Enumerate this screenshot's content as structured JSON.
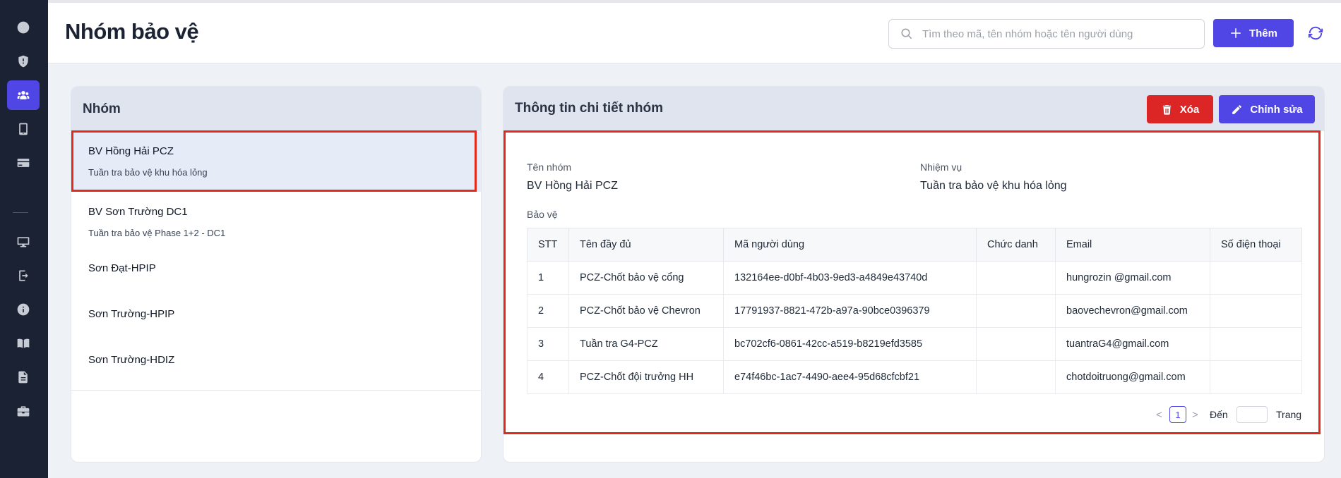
{
  "header": {
    "title": "Nhóm bảo vệ",
    "search_placeholder": "Tìm theo mã, tên nhóm hoặc tên người dùng",
    "add_label": "Thêm"
  },
  "sidebar": {
    "items": [
      {
        "icon": "clock-icon"
      },
      {
        "icon": "shield-icon"
      },
      {
        "icon": "users-icon",
        "active": true
      },
      {
        "icon": "tablet-icon"
      },
      {
        "icon": "credit-card-icon"
      },
      {
        "icon": "monitor-icon"
      },
      {
        "icon": "login-icon"
      },
      {
        "icon": "info-icon"
      },
      {
        "icon": "book-icon"
      },
      {
        "icon": "file-icon"
      },
      {
        "icon": "briefcase-icon"
      }
    ]
  },
  "groups_panel": {
    "title": "Nhóm",
    "items": [
      {
        "name": "BV Hồng Hải PCZ",
        "desc": "Tuần tra bảo vệ khu hóa lỏng"
      },
      {
        "name": "BV Sơn Trường DC1",
        "desc": "Tuần tra bảo vệ Phase 1+2 - DC1"
      },
      {
        "name": "Sơn Đạt-HPIP",
        "desc": ""
      },
      {
        "name": "Sơn Trường-HPIP",
        "desc": ""
      },
      {
        "name": "Sơn Trường-HDIZ",
        "desc": ""
      }
    ]
  },
  "detail_panel": {
    "title": "Thông tin chi tiết nhóm",
    "delete_label": "Xóa",
    "edit_label": "Chỉnh sửa",
    "group_name_label": "Tên nhóm",
    "group_name_value": "BV Hồng Hải PCZ",
    "mission_label": "Nhiệm vụ",
    "mission_value": "Tuần tra bảo vệ khu hóa lỏng",
    "guards_label": "Bảo vệ",
    "table": {
      "headers": [
        "STT",
        "Tên đầy đủ",
        "Mã người dùng",
        "Chức danh",
        "Email",
        "Số điện thoại"
      ],
      "rows": [
        [
          "1",
          "PCZ-Chốt bảo vệ cổng",
          "132164ee-d0bf-4b03-9ed3-a4849e43740d",
          "",
          "hungrozin @gmail.com",
          ""
        ],
        [
          "2",
          "PCZ-Chốt bảo vệ Chevron",
          "17791937-8821-472b-a97a-90bce0396379",
          "",
          "baovechevron@gmail.com",
          ""
        ],
        [
          "3",
          "Tuần tra G4-PCZ",
          "bc702cf6-0861-42cc-a519-b8219efd3585",
          "",
          "tuantraG4@gmail.com",
          ""
        ],
        [
          "4",
          "PCZ-Chốt đội trưởng HH",
          "e74f46bc-1ac7-4490-aee4-95d68cfcbf21",
          "",
          "chotdoitruong@gmail.com",
          ""
        ]
      ]
    },
    "pagination": {
      "prev": "<",
      "current_page": "1",
      "next": ">",
      "goto_label": "Đến",
      "page_label": "Trang"
    }
  },
  "colors": {
    "accent": "#4f46e5",
    "danger": "#dc2626",
    "sidebar_bg": "#1b2233",
    "highlight_box": "#e02a1b"
  }
}
